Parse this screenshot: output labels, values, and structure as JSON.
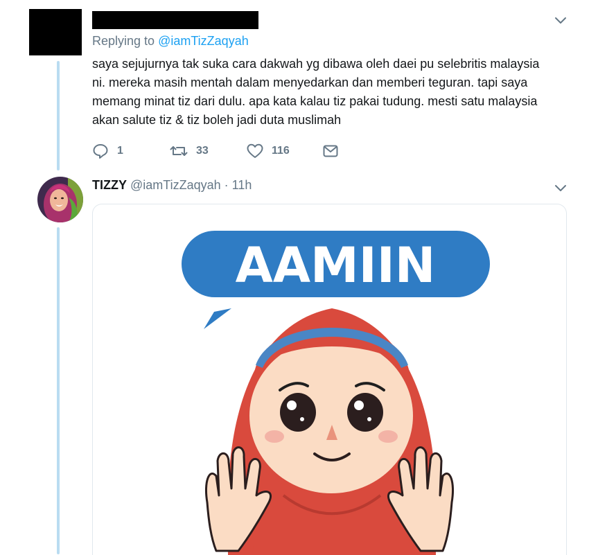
{
  "reply_tweet": {
    "replying_prefix": "Replying to",
    "replying_handle": "@iamTizZaqyah",
    "text_lines": [
      "saya sejujurnya tak suka cara dakwah yg dibawa oleh daei pu selebritis malaysia",
      "ni. mereka masih mentah dalam menyedarkan dan memberi teguran. tapi saya",
      "memang minat tiz dari dulu. apa kata kalau tiz pakai tudung. mesti satu malaysia",
      "akan salute tiz & tiz boleh jadi duta muslimah"
    ],
    "actions": {
      "reply_count": "1",
      "retweet_count": "33",
      "like_count": "116"
    }
  },
  "tizzy_tweet": {
    "display_name": "TIZZY",
    "handle": "@iamTizZaqyah",
    "time": "· 11h",
    "media": {
      "bubble_text": "AAMIIN"
    }
  },
  "colors": {
    "thread_line": "#b9dcf1",
    "link_blue": "#1da1f2",
    "secondary_text": "#657786",
    "bubble_blue": "#2f7cc4",
    "hijab_red": "#d94a3d"
  },
  "icons": [
    "chevron-down-icon",
    "reply-icon",
    "retweet-icon",
    "heart-icon",
    "message-icon"
  ]
}
